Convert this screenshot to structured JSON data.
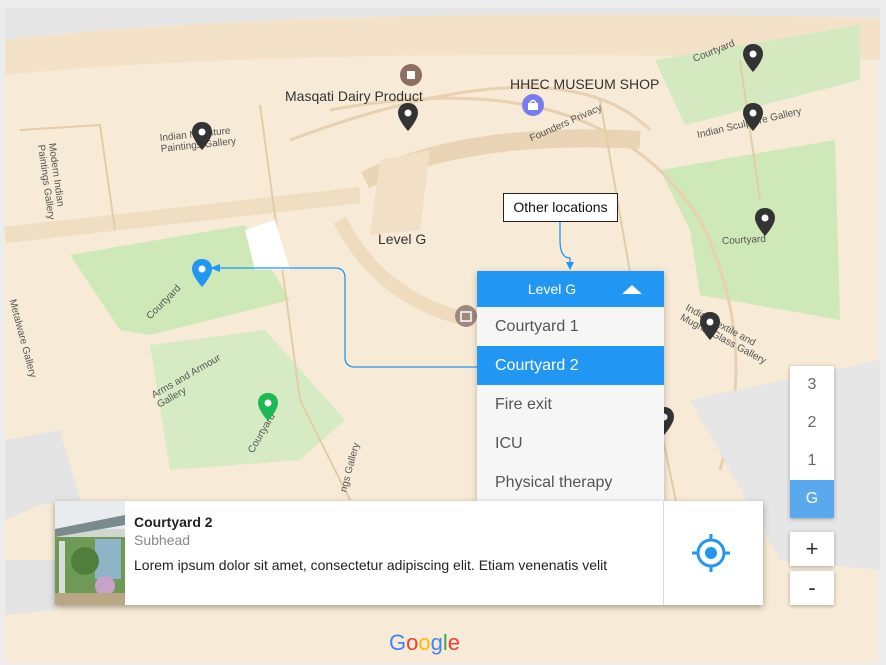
{
  "map": {
    "level_label": "Level G",
    "labels": {
      "masqati": "Masqati Dairy Product",
      "museum_shop": "HHEC MUSEUM SHOP",
      "founders": "Founders Privacy",
      "indian_miniature": "Indian Miniature Paintings Gallery",
      "modern_indian": "Modern Indian Paintings Gallery",
      "metalware": "Metalware Gallery",
      "arms_armour": "Arms and Armour Gallery",
      "courtyard": "Courtyard",
      "indian_sculpture": "Indian Sculpture Gallery",
      "textile": "Indian Textile and Mughal Glass Gallery",
      "gallery_bottom": "ngs Gallery"
    }
  },
  "callout": {
    "text": "Other locations"
  },
  "dropdown": {
    "selected_level": "Level G",
    "items": [
      {
        "label": "Courtyard 1"
      },
      {
        "label": "Courtyard 2"
      },
      {
        "label": "Fire exit"
      },
      {
        "label": "ICU"
      },
      {
        "label": "Physical therapy"
      }
    ],
    "selected_item": "Courtyard 2"
  },
  "floors": {
    "items": [
      "3",
      "2",
      "1",
      "G"
    ],
    "selected": "G"
  },
  "zoom": {
    "in_label": "+",
    "out_label": "-"
  },
  "card": {
    "title": "Courtyard 2",
    "subhead": "Subhead",
    "description": "Lorem ipsum dolor sit amet, consectetur adipiscing elit. Etiam venenatis velit"
  },
  "brand": {
    "google": "Google"
  },
  "colors": {
    "accent": "#2196f3",
    "map_bg": "#f7ead6",
    "park": "#cfe8b8",
    "green_pin": "#1db954",
    "dark_pin": "#333333"
  },
  "icons": [
    "place-pin-icon",
    "shop-icon",
    "museum-icon",
    "locate-icon",
    "caret-up-icon"
  ]
}
